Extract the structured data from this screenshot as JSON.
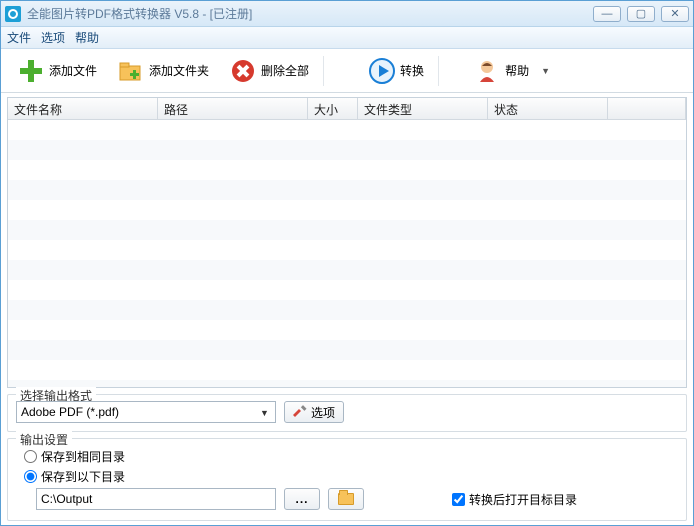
{
  "title": "全能图片转PDF格式转换器 V5.8 -  [已注册]",
  "menu": {
    "file": "文件",
    "options": "选项",
    "help": "帮助"
  },
  "toolbar": {
    "add_file": "添加文件",
    "add_folder": "添加文件夹",
    "delete_all": "删除全部",
    "convert": "转换",
    "help": "帮助"
  },
  "table": {
    "columns": {
      "name": "文件名称",
      "path": "路径",
      "size": "大小",
      "type": "文件类型",
      "status": "状态"
    }
  },
  "format_section": {
    "title": "选择输出格式",
    "selected": "Adobe PDF (*.pdf)",
    "options_btn": "选项"
  },
  "output_section": {
    "title": "输出设置",
    "save_same": "保存到相同目录",
    "save_below": "保存到以下目录",
    "path": "C:\\Output",
    "open_after": "转换后打开目标目录"
  }
}
